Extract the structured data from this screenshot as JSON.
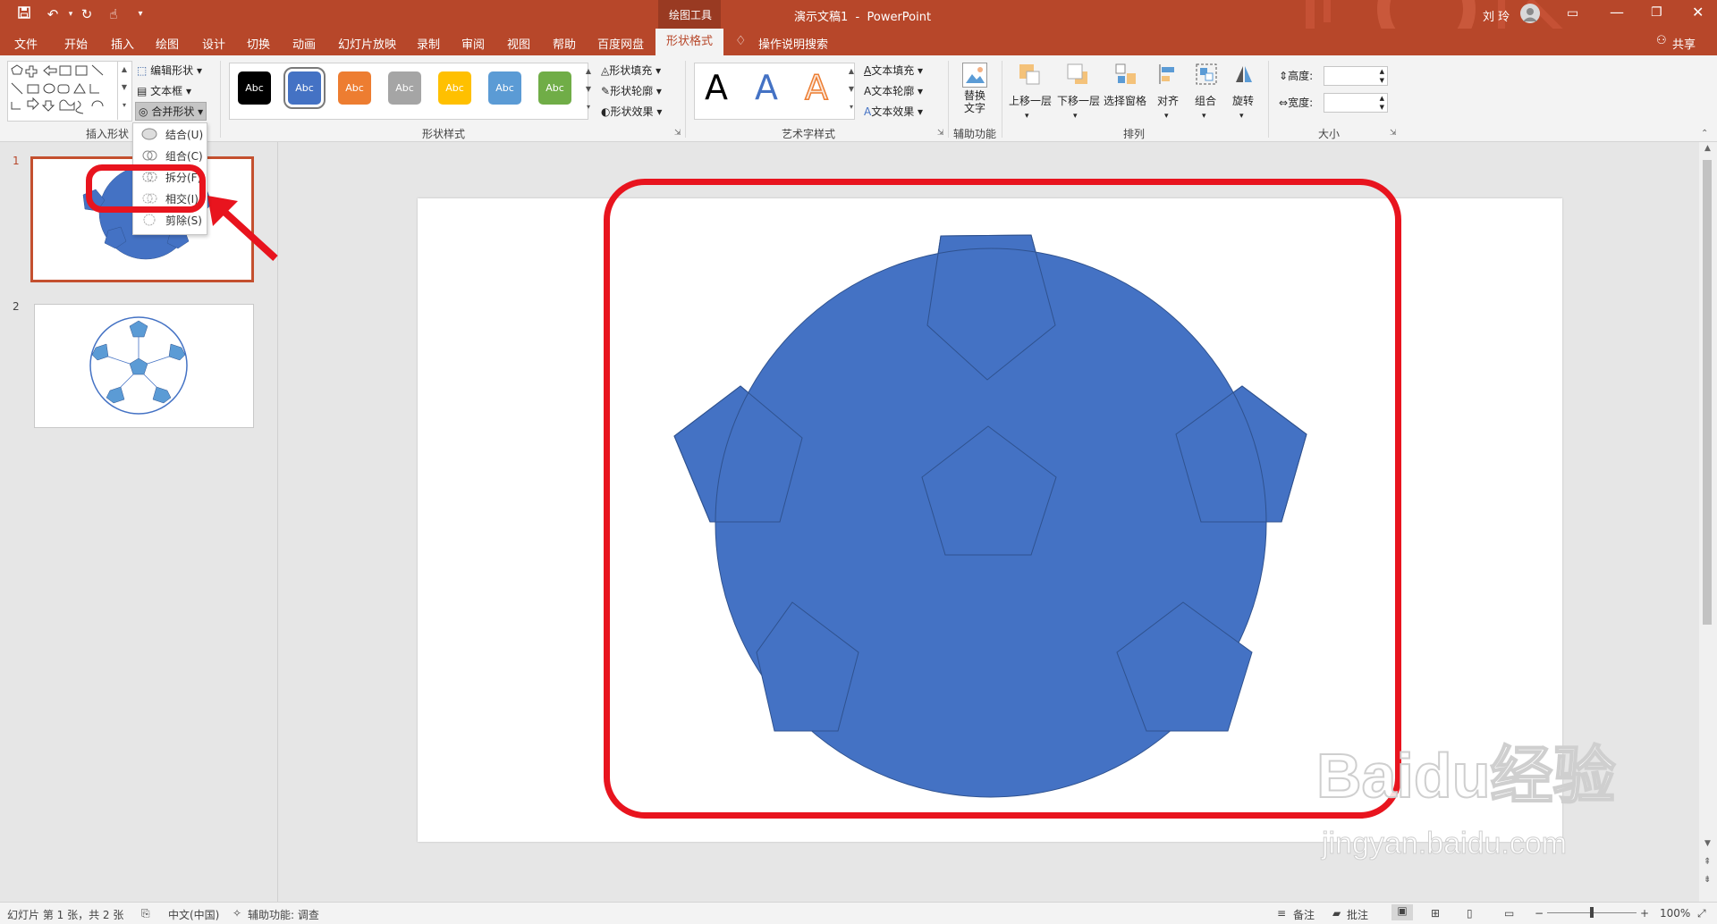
{
  "titlebar": {
    "quick_access": {
      "save": "save-icon",
      "undo": "undo-icon",
      "redo": "redo-icon",
      "touch": "touch-mode-icon",
      "customize": "customize-icon"
    },
    "context_tab_group": "绘图工具",
    "title": "演示文稿1  -  PowerPoint",
    "user": "刘 玲"
  },
  "tabs": [
    "文件",
    "开始",
    "插入",
    "绘图",
    "设计",
    "切换",
    "动画",
    "幻灯片放映",
    "录制",
    "审阅",
    "视图",
    "帮助",
    "百度网盘",
    "形状格式"
  ],
  "active_tab": "形状格式",
  "tell_me": "操作说明搜索",
  "share": "共享",
  "ribbon": {
    "insert_shapes": {
      "label": "插入形状",
      "edit_shape": "编辑形状",
      "text_box": "文本框",
      "merge_shapes": "合并形状"
    },
    "shape_styles": {
      "label": "形状样式",
      "style_text": "Abc",
      "style_colors": [
        "#000000",
        "#4472c4",
        "#ed7d31",
        "#a5a5a5",
        "#ffc000",
        "#5b9bd5",
        "#70ad47"
      ],
      "fill": "形状填充",
      "outline": "形状轮廓",
      "effects": "形状效果"
    },
    "wordart": {
      "label": "艺术字样式",
      "sample": "A",
      "text_fill": "文本填充",
      "text_outline": "文本轮廓",
      "text_effects": "文本效果"
    },
    "accessibility": {
      "label": "辅助功能",
      "alt_text": "替换文字"
    },
    "arrange": {
      "label": "排列",
      "bring_forward": "上移一层",
      "send_backward": "下移一层",
      "selection_pane": "选择窗格",
      "align": "对齐",
      "group": "组合",
      "rotate": "旋转"
    },
    "size": {
      "label": "大小",
      "height": "高度:",
      "width": "宽度:"
    }
  },
  "merge_menu": {
    "items": [
      "结合(U)",
      "组合(C)",
      "拆分(F)",
      "相交(I)",
      "剪除(S)"
    ]
  },
  "thumbnails": [
    "1",
    "2"
  ],
  "slide_colors": {
    "shape_fill": "#4472c4",
    "shape_stroke": "#2f528f",
    "highlight": "#e8141e"
  },
  "status": {
    "slide_info": "幻灯片 第 1 张，共 2 张",
    "language": "中文(中国)",
    "accessibility": "辅助功能: 调查",
    "notes": "备注",
    "comments": "批注",
    "zoom": "100%"
  },
  "watermark": {
    "brand": "Baidu经验",
    "url": "jingyan.baidu.com"
  }
}
